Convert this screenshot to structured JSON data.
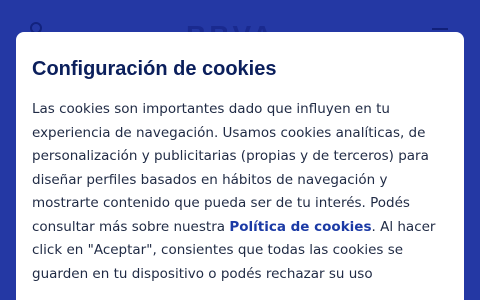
{
  "background": {
    "logo_text": "BBVA",
    "brand_color": "#2438a4"
  },
  "modal": {
    "title": "Configuración de cookies",
    "body_line_1": "Las cookies son importantes dado que influyen en tu",
    "body_line_2": "experiencia de navegación. Usamos cookies analíticas, de",
    "body_line_3": "personalización y publicitarias (propias y de terceros) para",
    "body_line_4": "diseñar perfiles basados en hábitos de navegación y",
    "body_line_5": "mostrarte contenido que pueda ser de tu interés. Podés",
    "body_line_6_before": "consultar más sobre nuestra ",
    "policy_link": "Política de cookies",
    "body_line_6_after": ". Al hacer",
    "body_line_7": "click en \"Aceptar\", consientes que todas las cookies se",
    "body_line_8": "guarden en tu dispositivo o podés rechazar su uso"
  }
}
